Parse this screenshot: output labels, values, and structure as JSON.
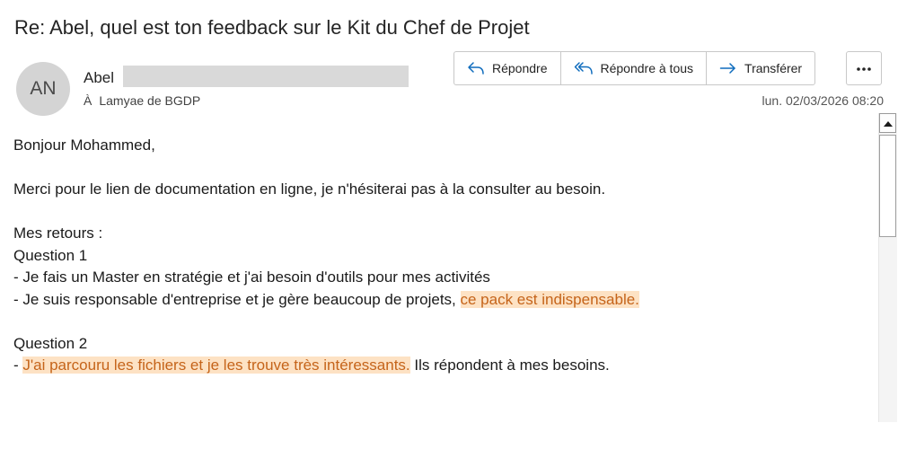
{
  "email": {
    "subject": "Re: Abel, quel est ton feedback sur le Kit du Chef de Projet",
    "sender": {
      "initials": "AN",
      "name": "Abel",
      "to_prefix": "À",
      "recipient": "Lamyae de BGDP"
    },
    "actions": {
      "reply_label": "Répondre",
      "reply_all_label": "Répondre à tous",
      "forward_label": "Transférer",
      "more_label": "..."
    },
    "datetime": "lun. 02/03/2026 08:20",
    "body": {
      "greeting": "Bonjour Mohammed,",
      "thanks": "Merci pour le lien de documentation en ligne, je n'hésiterai pas à la consulter au besoin.",
      "retours_header": "Mes retours :",
      "question1_header": "Question 1",
      "q1_line1": "- Je fais un Master en stratégie et j'ai besoin d'outils pour mes activités",
      "q1_line2_prefix": "- Je suis responsable d'entreprise et je gère beaucoup de projets, ",
      "q1_line2_highlight": "ce pack est indispensable. ",
      "question2_header": "Question 2",
      "q2_line1_prefix": "- ",
      "q2_line1_highlight": "J'ai parcouru les fichiers et je les trouve très intéressants.",
      "q2_line1_suffix": " Ils répondent à mes besoins."
    },
    "colors": {
      "highlight_bg": "#fde2c4",
      "highlight_text": "#c5641a",
      "accent_blue": "#0f6cbd"
    }
  },
  "icons": {
    "reply": "reply-arrow-icon",
    "reply_all": "reply-all-arrow-icon",
    "forward": "forward-arrow-icon",
    "more": "more-dots-icon",
    "scroll_up": "scroll-up-arrow-icon"
  }
}
